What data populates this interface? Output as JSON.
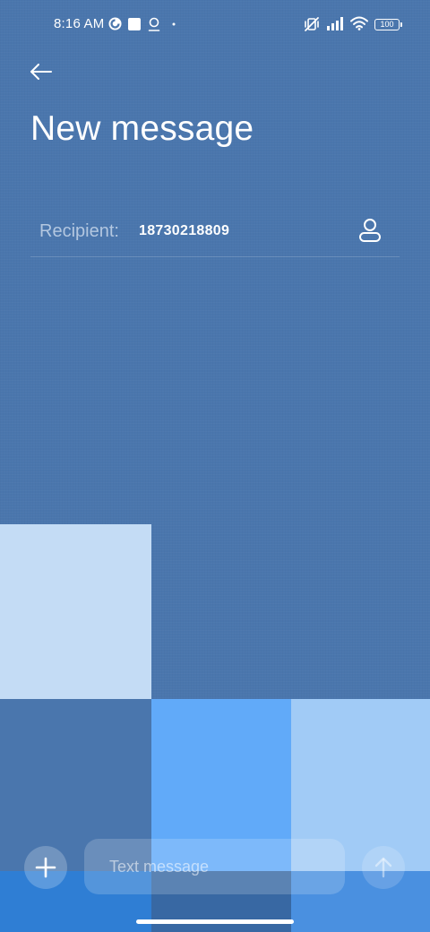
{
  "status_bar": {
    "time": "8:16 AM",
    "icons": [
      "data-saver-icon",
      "stop-square-icon",
      "location-pin-icon",
      "dot-icon",
      "vibrate-off-icon",
      "signal-icon",
      "wifi-icon"
    ],
    "battery_level": "100"
  },
  "header": {
    "back_icon": "arrow-left-icon",
    "title": "New message"
  },
  "recipient": {
    "label": "Recipient:",
    "value": "18730218809",
    "contact_icon": "person-icon"
  },
  "composer": {
    "add_icon": "plus-icon",
    "input_placeholder": "Text message",
    "input_value": "",
    "send_icon": "arrow-up-icon"
  },
  "colors": {
    "background": "#4a76ad",
    "tile_light": "#c4dcf5",
    "tile_bright": "#61aaf9",
    "tile_pale": "#a1cbf6",
    "tile_deep": "#2f7ed4"
  }
}
